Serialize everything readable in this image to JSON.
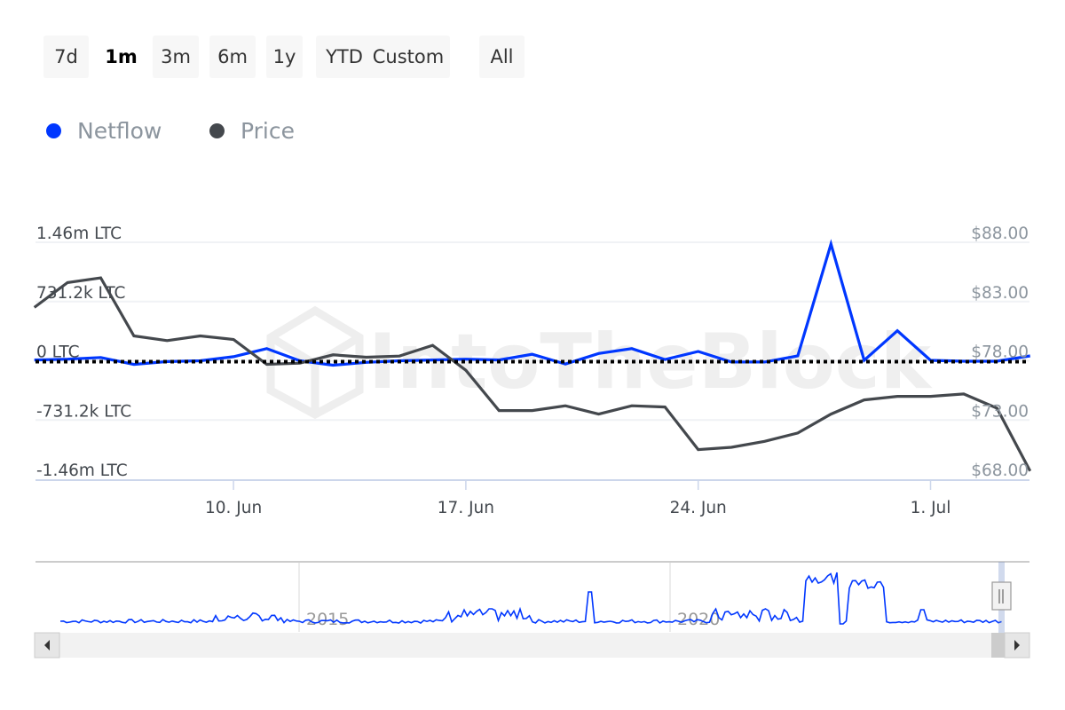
{
  "range_selector": {
    "buttons": [
      "7d",
      "1m",
      "3m",
      "6m",
      "1y",
      "YTD",
      "Custom",
      "All"
    ],
    "active": "1m"
  },
  "legend": {
    "items": [
      {
        "label": "Netflow",
        "color": "#0037ff"
      },
      {
        "label": "Price",
        "color": "#44484d"
      }
    ]
  },
  "watermark": "IntoTheBlock",
  "chart_data": {
    "type": "line",
    "x": [
      "4 Jun",
      "5 Jun",
      "6 Jun",
      "7 Jun",
      "8 Jun",
      "9 Jun",
      "10 Jun",
      "11 Jun",
      "12 Jun",
      "13 Jun",
      "14 Jun",
      "15 Jun",
      "16 Jun",
      "17 Jun",
      "18 Jun",
      "19 Jun",
      "20 Jun",
      "21 Jun",
      "22 Jun",
      "23 Jun",
      "24 Jun",
      "25 Jun",
      "26 Jun",
      "27 Jun",
      "28 Jun",
      "29 Jun",
      "30 Jun",
      "1 Jul",
      "2 Jul",
      "3 Jul",
      "4 Jul"
    ],
    "x_ticks": [
      "10. Jun",
      "17. Jun",
      "24. Jun",
      "1. Jul"
    ],
    "x_tick_index": [
      6,
      13,
      20,
      27
    ],
    "series": [
      {
        "name": "Netflow",
        "axis": "left",
        "color": "#0037ff",
        "values": [
          10000,
          20000,
          40000,
          -45000,
          -10000,
          0,
          50000,
          150000,
          0,
          -55000,
          -20000,
          0,
          10000,
          20000,
          10000,
          80000,
          -40000,
          90000,
          150000,
          15000,
          115000,
          -15000,
          -15000,
          60000,
          1440000,
          5000,
          370000,
          5000,
          -5000,
          -5000,
          60000
        ]
      },
      {
        "name": "Price",
        "axis": "right",
        "color": "#44484d",
        "values": [
          82.5,
          84.6,
          85.0,
          80.1,
          79.7,
          80.1,
          79.8,
          77.7,
          77.8,
          78.5,
          78.3,
          78.4,
          79.3,
          77.2,
          73.8,
          73.8,
          74.2,
          73.5,
          74.2,
          74.1,
          70.5,
          70.7,
          71.2,
          71.9,
          73.5,
          74.7,
          75.0,
          75.0,
          75.2,
          74.0,
          68.7
        ]
      }
    ],
    "y_left": {
      "ticks": [
        "1.46m LTC",
        "731.2k LTC",
        "0 LTC",
        "-731.2k LTC",
        "-1.46m LTC"
      ],
      "range": [
        -1462400,
        1462400
      ]
    },
    "y_right": {
      "ticks": [
        "$88.00",
        "$83.00",
        "$78.00",
        "$73.00",
        "$68.00"
      ],
      "range": [
        68,
        88
      ]
    },
    "zero_line": "dotted",
    "grid": true,
    "navigator": {
      "labels": [
        "2015",
        "2020"
      ]
    }
  }
}
